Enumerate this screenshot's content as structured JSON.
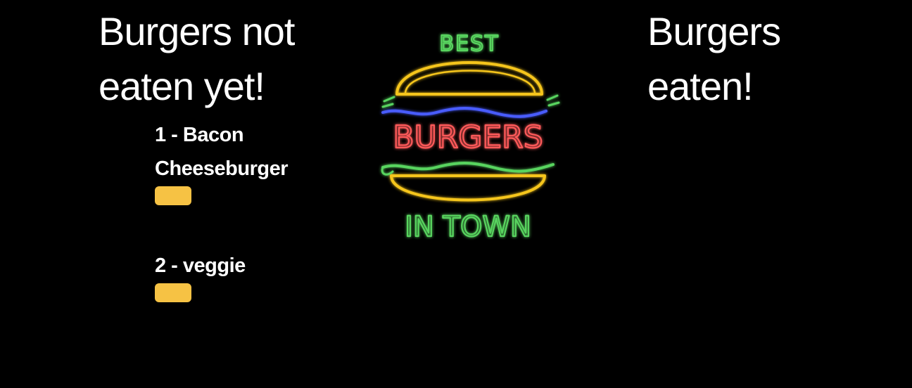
{
  "not_eaten": {
    "heading": "Burgers not eaten yet!",
    "items": [
      {
        "label": "1 - Bacon Cheeseburger",
        "button_label": ""
      },
      {
        "label": "2 - veggie",
        "button_label": ""
      }
    ]
  },
  "eaten": {
    "heading": "Burgers eaten!"
  },
  "sign": {
    "top_text": "BEST",
    "middle_text": "BURGERS",
    "bottom_text": "IN TOWN"
  },
  "colors": {
    "background": "#000000",
    "button": "#f6c244",
    "neon_green": "#59d45f",
    "neon_yellow": "#f5c51b",
    "neon_blue": "#4a5cff",
    "neon_red": "#ff5a5a"
  }
}
